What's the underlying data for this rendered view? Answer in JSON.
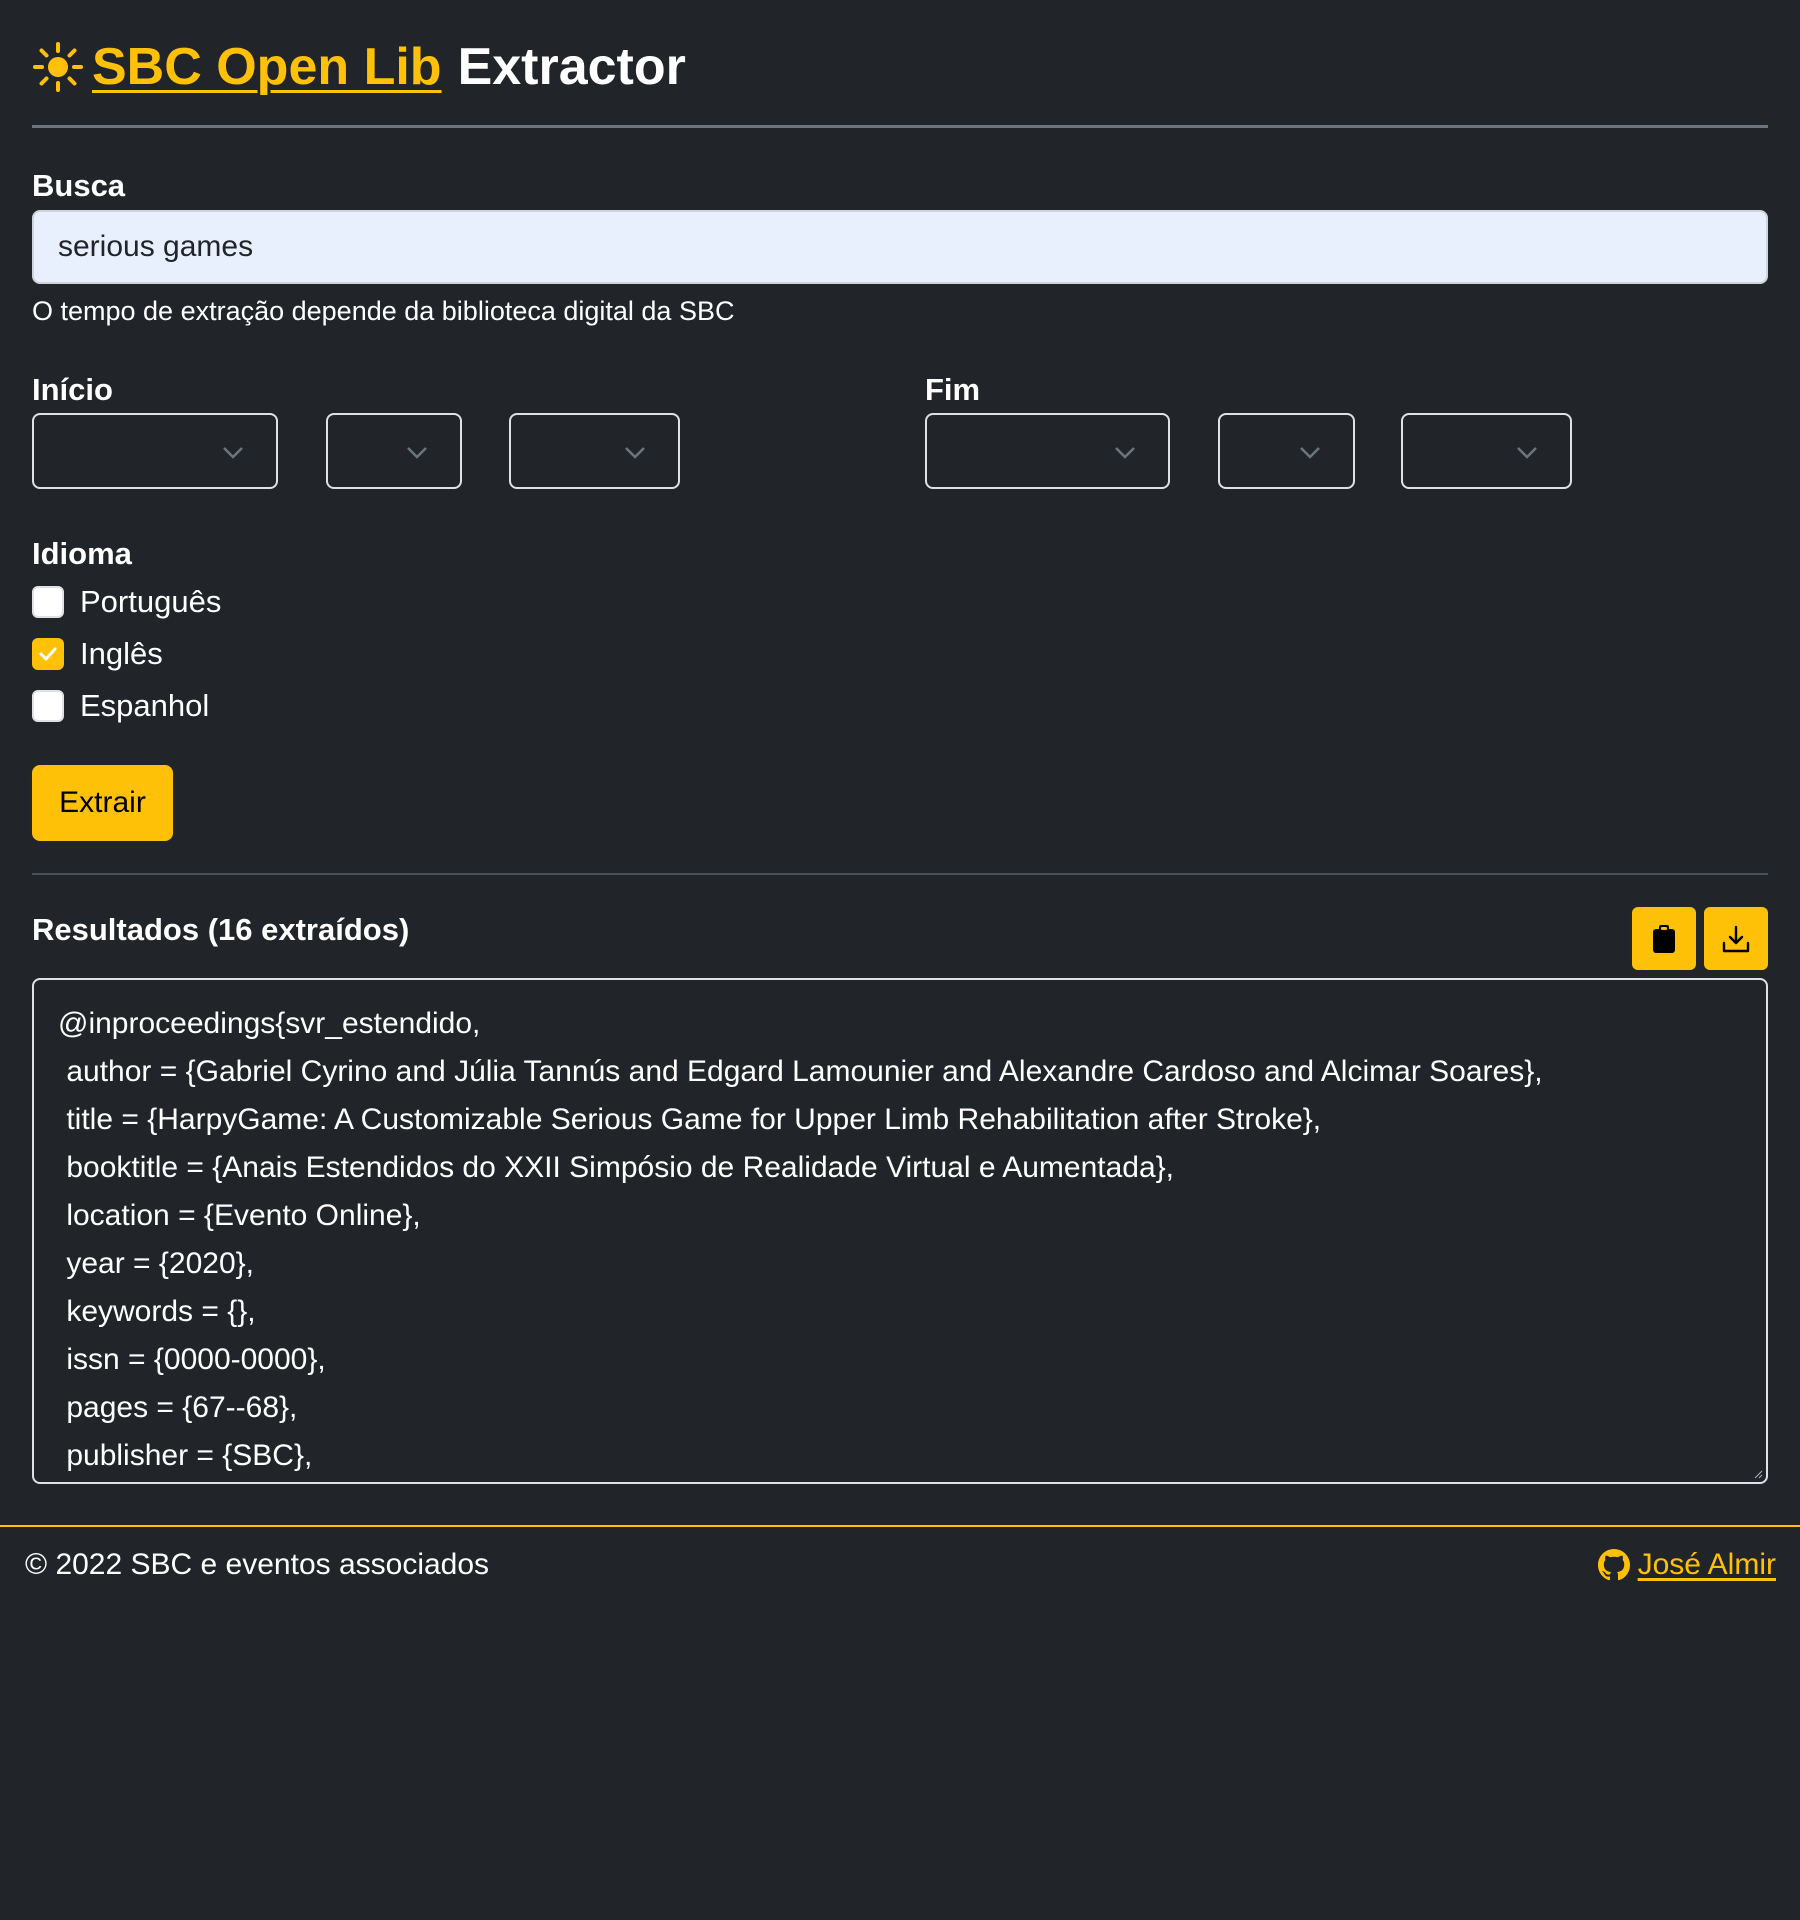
{
  "header": {
    "brand_link": "SBC Open Lib",
    "title_suffix": "Extractor",
    "icon": "sun-icon"
  },
  "search": {
    "label": "Busca",
    "value": "serious games",
    "help_text": "O tempo de extração depende da biblioteca digital da SBC"
  },
  "date_range": {
    "start_label": "Início",
    "end_label": "Fim",
    "start_selects": [
      "",
      "",
      ""
    ],
    "end_selects": [
      "",
      "",
      ""
    ]
  },
  "language": {
    "label": "Idioma",
    "options": [
      {
        "label": "Português",
        "checked": false
      },
      {
        "label": "Inglês",
        "checked": true
      },
      {
        "label": "Espanhol",
        "checked": false
      }
    ]
  },
  "actions": {
    "extract_label": "Extrair"
  },
  "results": {
    "title": "Resultados (16 extraídos)",
    "copy_icon": "clipboard-icon",
    "download_icon": "download-icon",
    "lines": [
      "@inproceedings{svr_estendido,",
      " author = {Gabriel Cyrino and Júlia Tannús and Edgard Lamounier and Alexandre Cardoso and Alcimar Soares},",
      " title = {HarpyGame: A Customizable Serious Game for Upper Limb Rehabilitation after Stroke},",
      " booktitle = {Anais Estendidos do XXII Simpósio de Realidade Virtual e Aumentada},",
      " location = {Evento Online},",
      " year = {2020},",
      " keywords = {},",
      " issn = {0000-0000},",
      " pages = {67--68},",
      " publisher = {SBC},"
    ]
  },
  "footer": {
    "copyright": "© 2022 SBC e eventos associados",
    "author_link": "José Almir",
    "author_icon": "github-icon"
  },
  "colors": {
    "background": "#212529",
    "accent": "#ffc107",
    "input_bg": "#e8f0fe"
  }
}
